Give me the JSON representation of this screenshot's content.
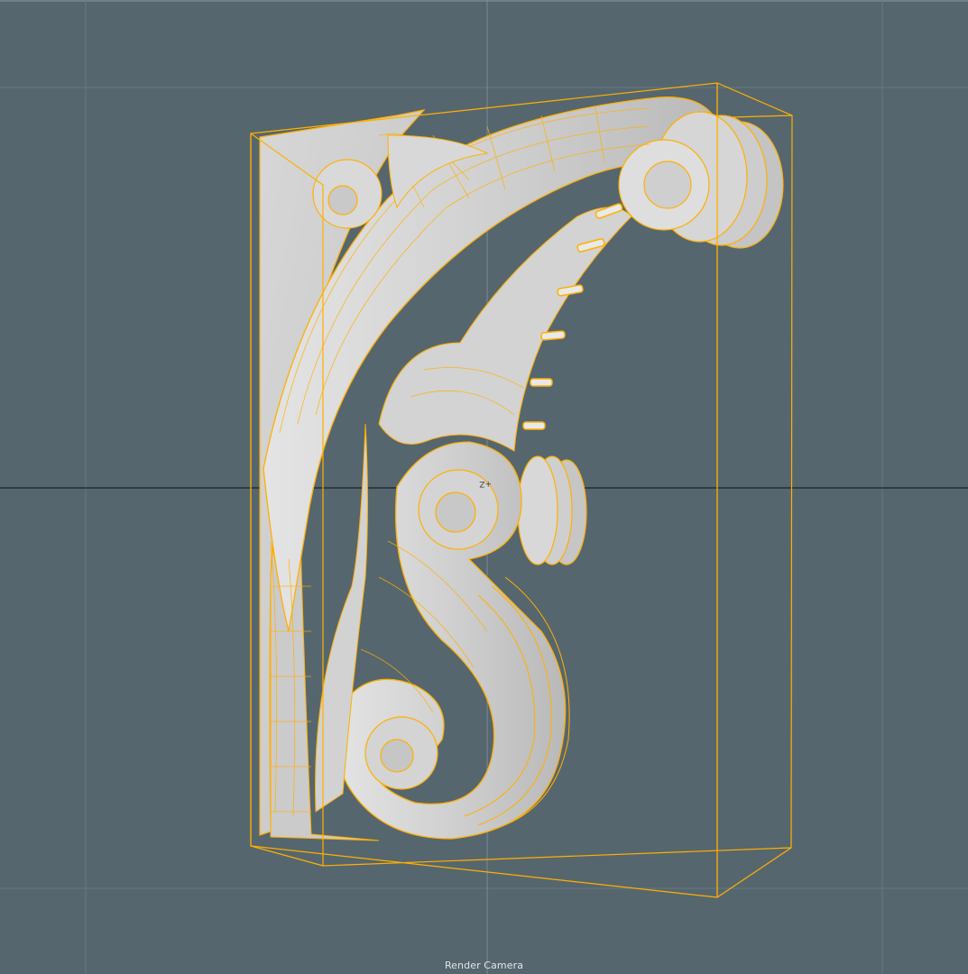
{
  "viewport": {
    "camera_label": "Render Camera",
    "axis_label": "+Z"
  },
  "colors": {
    "background": "#56666e",
    "grid": "#6a7b84",
    "axis_main": "#1c2226",
    "wireframe": "#ffb000",
    "model_surface": "#cfcfcf"
  },
  "icons": {
    "axis": "axis-gizmo-icon"
  }
}
